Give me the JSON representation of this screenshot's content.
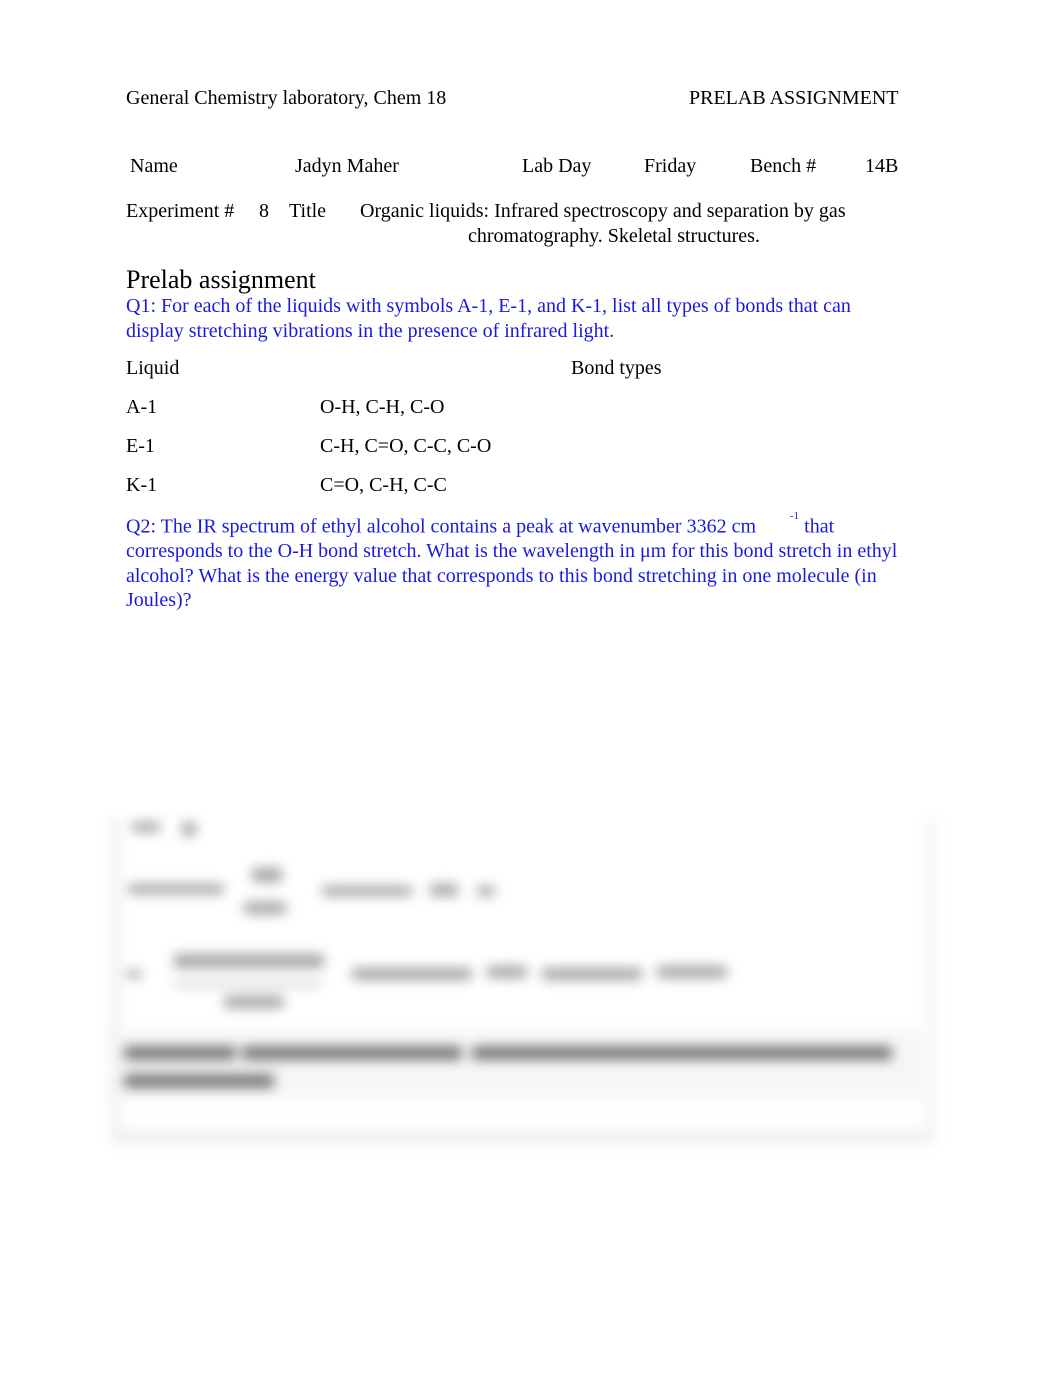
{
  "header": {
    "course": "General Chemistry laboratory, Chem 18",
    "doc_type": "PRELAB ASSIGNMENT"
  },
  "info": {
    "name_label": "Name",
    "name_value": "Jadyn Maher",
    "labday_label": "Lab Day",
    "labday_value": "Friday",
    "bench_label": "Bench #",
    "bench_value": "14B",
    "experiment_label": "Experiment #",
    "experiment_value": "8",
    "title_label": "Title",
    "title_line1": "Organic liquids: Infrared spectroscopy and separation by gas",
    "title_line2": "chromatography. Skeletal structures."
  },
  "section_title": "Prelab assignment",
  "q1": {
    "text": "Q1: For each of the liquids with symbols A-1, E-1, and K-1, list all types of bonds that can display stretching vibrations in the presence of infrared light.",
    "table": {
      "col_liquid": "Liquid",
      "col_bonds": "Bond types",
      "rows": [
        {
          "liquid": "A-1",
          "bonds": "O-H, C-H, C-O"
        },
        {
          "liquid": "E-1",
          "bonds": "C-H, C=O, C-C, C-O"
        },
        {
          "liquid": "K-1",
          "bonds": "C=O, C-H, C-C"
        }
      ]
    }
  },
  "q2": {
    "text_before": "Q2: The IR spectrum of ethyl alcohol contains a peak at wavenumber 3362 cm",
    "superscript": "-1",
    "text_after": " that corresponds to the O-H bond stretch. What is the wavelength in μm for this bond stretch in ethyl alcohol? What is the energy value that corresponds to this bond stretching in one molecule (in Joules)?"
  }
}
